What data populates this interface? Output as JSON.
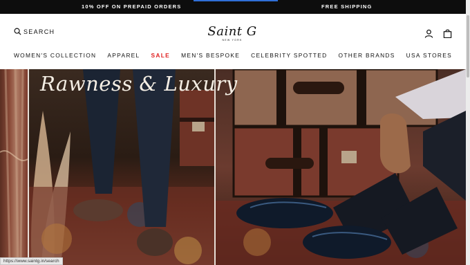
{
  "announcement": {
    "left": "10% OFF ON PREPAID ORDERS",
    "right": "FREE SHIPPING"
  },
  "header": {
    "search_label": "SEARCH",
    "logo_name": "Saint G",
    "logo_sub": "NEW YORK"
  },
  "nav": {
    "items": [
      {
        "label": "WOMEN'S COLLECTION"
      },
      {
        "label": "APPAREL"
      },
      {
        "label": "SALE"
      },
      {
        "label": "MEN'S BESPOKE"
      },
      {
        "label": "CELEBRITY SPOTTED"
      },
      {
        "label": "OTHER BRANDS"
      },
      {
        "label": "USA STORES"
      }
    ]
  },
  "hero": {
    "title": "Rawness & Luxury"
  },
  "status_bar": {
    "url": "https://www.saintg.in/search"
  },
  "colors": {
    "announcement_bg": "#0d0d0d",
    "sale": "#e02020"
  },
  "icons": [
    "search-icon",
    "account-icon",
    "cart-icon"
  ]
}
